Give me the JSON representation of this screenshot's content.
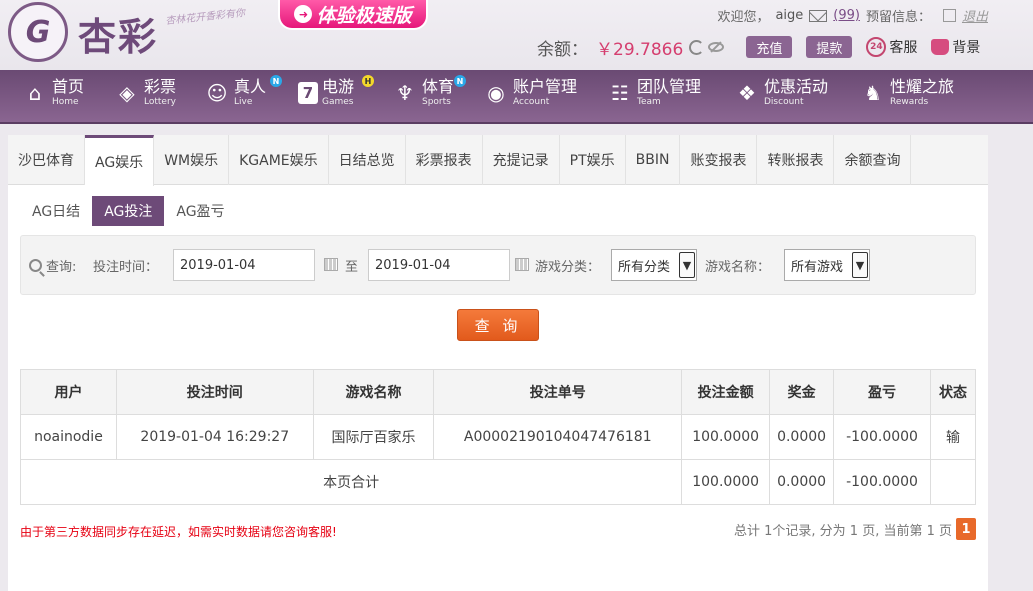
{
  "header": {
    "logo_text": "杏彩",
    "slogan": "杏林花开香彩有你",
    "speed_badge": "体验极速版",
    "welcome_label": "欢迎您，",
    "username": "aige",
    "message_count": "(99)",
    "alert_label": "预留信息：",
    "logout_label": "退出",
    "balance_label": "余额：",
    "balance_value": "￥29.7866",
    "deposit_label": "充值",
    "withdraw_label": "提款",
    "service_label": "客服",
    "background_label": "背景"
  },
  "nav": [
    {
      "cn": "首页",
      "en": "Home",
      "icon": "home-icon"
    },
    {
      "cn": "彩票",
      "en": "Lottery",
      "icon": "ticket-icon"
    },
    {
      "cn": "真人",
      "en": "Live",
      "icon": "person-icon",
      "badge": "N"
    },
    {
      "cn": "电游",
      "en": "Games",
      "icon": "slot-icon",
      "badge": "H"
    },
    {
      "cn": "体育",
      "en": "Sports",
      "icon": "trophy-icon",
      "badge": "N"
    },
    {
      "cn": "账户管理",
      "en": "Account",
      "icon": "account-icon"
    },
    {
      "cn": "团队管理",
      "en": "Team",
      "icon": "team-icon"
    },
    {
      "cn": "优惠活动",
      "en": "Discount",
      "icon": "gift-icon"
    },
    {
      "cn": "性耀之旅",
      "en": "Rewards",
      "icon": "rewards-icon"
    }
  ],
  "tabs": [
    "沙巴体育",
    "AG娱乐",
    "WM娱乐",
    "KGAME娱乐",
    "日结总览",
    "彩票报表",
    "充提记录",
    "PT娱乐",
    "BBIN",
    "账变报表",
    "转账报表",
    "余额查询"
  ],
  "subtabs": [
    "AG日结",
    "AG投注",
    "AG盈亏"
  ],
  "filter": {
    "query_label": "查询:",
    "time_label": "投注时间：",
    "date_from": "2019-01-04",
    "to_label": "至",
    "date_to": "2019-01-04",
    "category_label": "游戏分类：",
    "category_value": "所有分类",
    "game_label": "游戏名称：",
    "game_value": "所有游戏",
    "query_button": "查 询"
  },
  "table": {
    "headers": [
      "用户",
      "投注时间",
      "游戏名称",
      "投注单号",
      "投注金额",
      "奖金",
      "盈亏",
      "状态"
    ],
    "rows": [
      {
        "user": "noainodie",
        "time": "2019-01-04 16:29:27",
        "game": "国际厅百家乐",
        "order": "A00002190104047476181",
        "amount": "100.0000",
        "bonus": "0.0000",
        "profit": "-100.0000",
        "status": "输"
      }
    ],
    "subtotal": {
      "label": "本页合计",
      "amount": "100.0000",
      "bonus": "0.0000",
      "profit": "-100.0000"
    }
  },
  "notice": "由于第三方数据同步存在延迟，如需实时数据请您咨询客服!",
  "pager": {
    "summary": "总计 1个记录, 分为 1 页, 当前第 1 页",
    "current": "1"
  },
  "colors": {
    "brand": "#6d4a78",
    "accent": "#e8692a",
    "negative": "#e60012"
  }
}
